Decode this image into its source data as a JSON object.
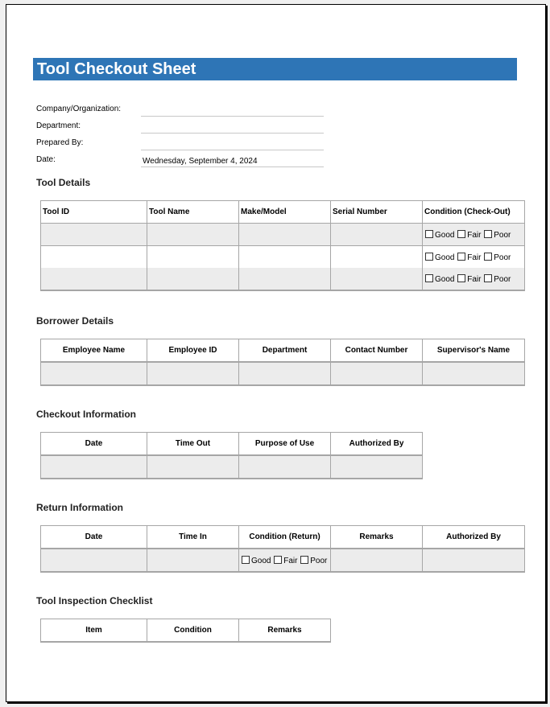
{
  "title": "Tool Checkout Sheet",
  "info": [
    {
      "label": "Company/Organization:",
      "value": ""
    },
    {
      "label": "Department:",
      "value": ""
    },
    {
      "label": "Prepared By:",
      "value": ""
    },
    {
      "label": "Date:",
      "value": "Wednesday, September 4, 2024"
    }
  ],
  "tool_details": {
    "title": "Tool Details",
    "headers": [
      "Tool ID",
      "Tool Name",
      "Make/Model",
      "Serial Number",
      "Condition (Check-Out)"
    ],
    "condition_options": [
      "Good",
      "Fair",
      "Poor"
    ]
  },
  "borrower_details": {
    "title": "Borrower Details",
    "headers": [
      "Employee Name",
      "Employee ID",
      "Department",
      "Contact Number",
      "Supervisor's Name"
    ]
  },
  "checkout_info": {
    "title": "Checkout Information",
    "headers": [
      "Date",
      "Time Out",
      "Purpose of Use",
      "Authorized By"
    ]
  },
  "return_info": {
    "title": "Return Information",
    "headers": [
      "Date",
      "Time In",
      "Condition (Return)",
      "Remarks",
      "Authorized By"
    ],
    "condition_options": [
      "Good",
      "Fair",
      "Poor"
    ]
  },
  "inspection": {
    "title": "Tool Inspection Checklist",
    "headers": [
      "Item",
      "Condition",
      "Remarks"
    ]
  }
}
